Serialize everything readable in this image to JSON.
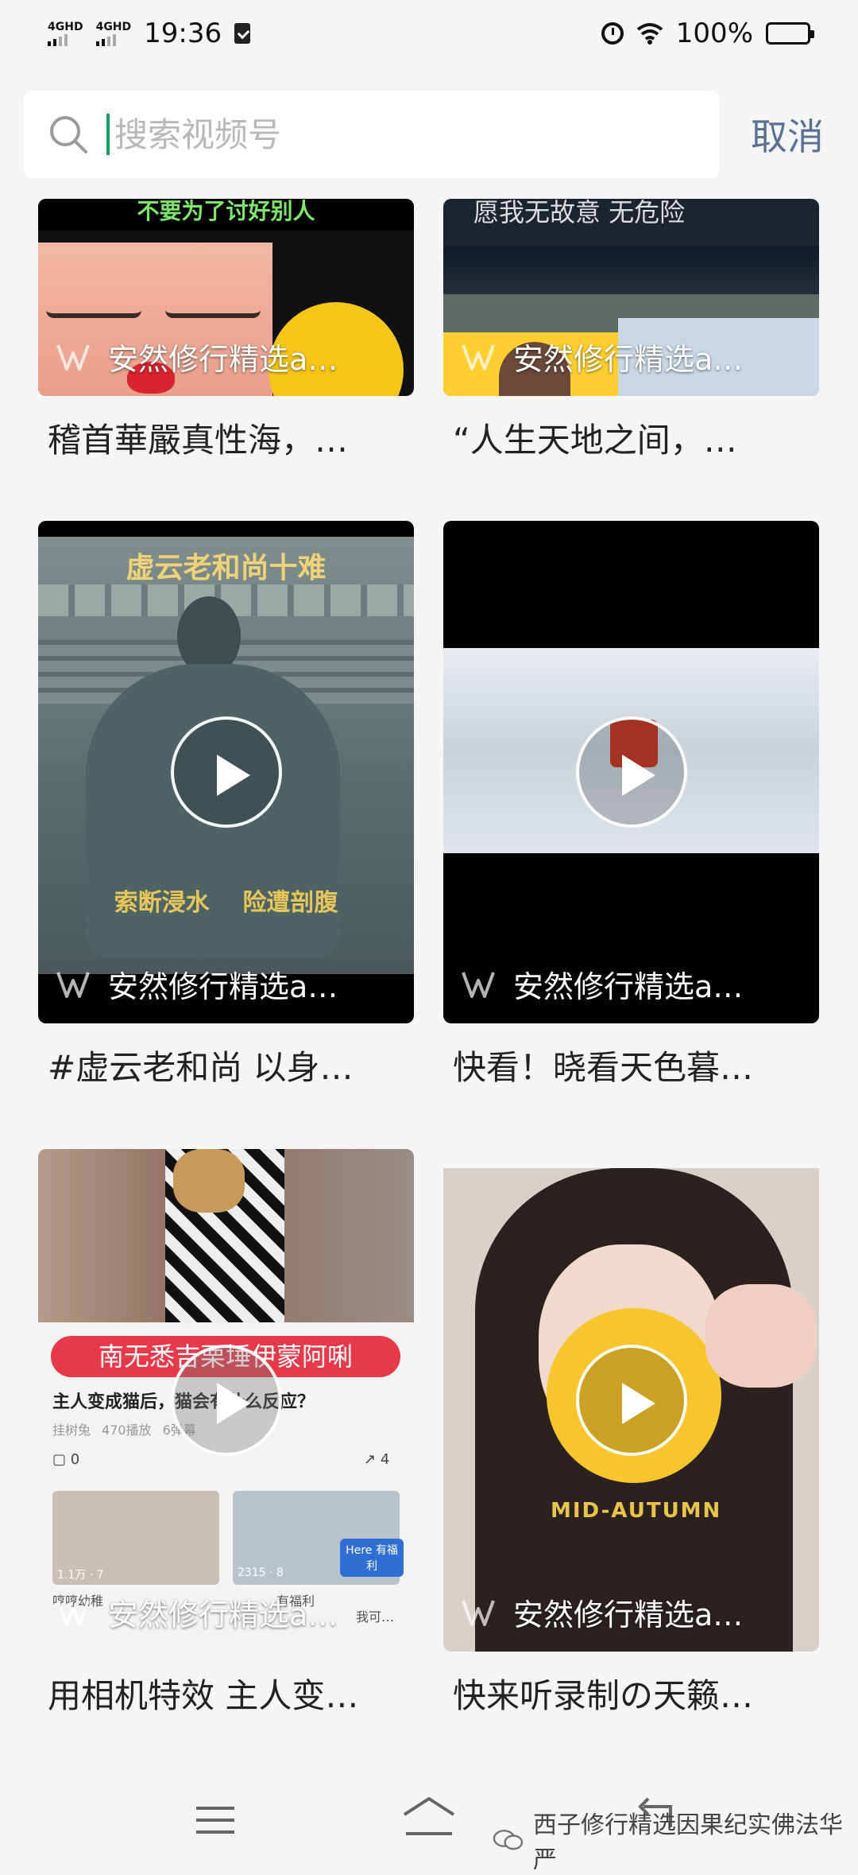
{
  "status_bar": {
    "signal1": "4GHD",
    "signal2": "4GHD",
    "time": "19:36",
    "battery": "100%"
  },
  "search": {
    "placeholder": "搜索视频号",
    "cancel_label": "取消"
  },
  "cards": [
    {
      "channel": "安然修行精选a…",
      "title": "稽首華嚴真性海，…",
      "thumb_top_text": "不要为了讨好别人",
      "has_play": false
    },
    {
      "channel": "安然修行精选a…",
      "title": "“人生天地之间，…",
      "thumb_top_text": "愿我无故意 无危险",
      "has_play": false
    },
    {
      "channel": "安然修行精选a…",
      "title": "#虚云老和尚 以身…",
      "thumb_top_text": "虚云老和尚十难",
      "thumb_bottom_text": "索断浸水    险遭剖腹",
      "has_play": true
    },
    {
      "channel": "安然修行精选a…",
      "title": "快看！晓看天色暮…",
      "has_play": true
    },
    {
      "channel": "安然修行精选a…",
      "title": "用相机特效 主人变…",
      "thumb_banner": "南无悉吉栗埵伊蒙阿唎",
      "thumb_sub": "主人变成猫后，猫会有什么反应？",
      "thumb_meta_user": "挂树兔",
      "thumb_meta_plays": "470播放",
      "thumb_meta_danmu": "6弹幕",
      "thumb_comments": "0",
      "thumb_shares": "4",
      "thumb_views1": "1.1万",
      "thumb_views1_b": "7",
      "thumb_views2": "2315",
      "thumb_views2_b": "8",
      "thumb_badge": "Here 有福利",
      "thumb_row1": "哼哼幼稚",
      "thumb_row2": "有福利",
      "thumb_row3": "我可…",
      "has_play": true
    },
    {
      "channel": "安然修行精选a…",
      "title": "快来听录制の天籁…",
      "thumb_text": "MID-AUTUMN",
      "has_play": true
    }
  ],
  "watermark": "西子修行精选因果纪实佛法华严",
  "colors": {
    "accent": "#5a6f94",
    "caret": "#18a05e",
    "banner": "#e8394a"
  }
}
